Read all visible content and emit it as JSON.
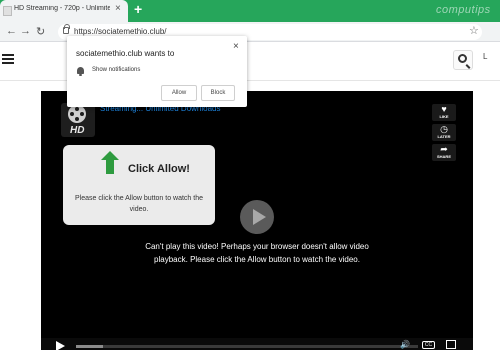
{
  "browser": {
    "tab_title": "HD Streaming - 720p - Unlimite",
    "tab_close": "×",
    "new_tab": "+",
    "url": "https://sociatemethio.club/",
    "watermark": "computips"
  },
  "nav": {
    "back": "←",
    "forward": "→",
    "reload": "↻"
  },
  "header": {
    "edge_text": "L"
  },
  "player": {
    "title": "Streaming... Unlimited Downloads",
    "logo_text": "HD",
    "side_buttons": [
      {
        "glyph": "♥",
        "label": "LIKE"
      },
      {
        "glyph": "◷",
        "label": "LATER"
      },
      {
        "glyph": "➦",
        "label": "SHARE"
      }
    ],
    "card": {
      "heading": "Click Allow!",
      "message": "Please click the Allow button to watch the video."
    },
    "error_message": "Can't play this video! Perhaps your browser doesn't allow video playback. Please click the Allow button to watch the video.",
    "progress": 0.08,
    "cc_label": "CC",
    "volume_glyph": "🔊"
  },
  "popup": {
    "title": "sociatemethio.club wants to",
    "permission": "Show notifications",
    "allow_label": "Allow",
    "block_label": "Block",
    "close": "×"
  },
  "colors": {
    "accent_green": "#26a65b",
    "allow_arrow": "#2e9b3f",
    "title_link": "#1e88e5"
  }
}
